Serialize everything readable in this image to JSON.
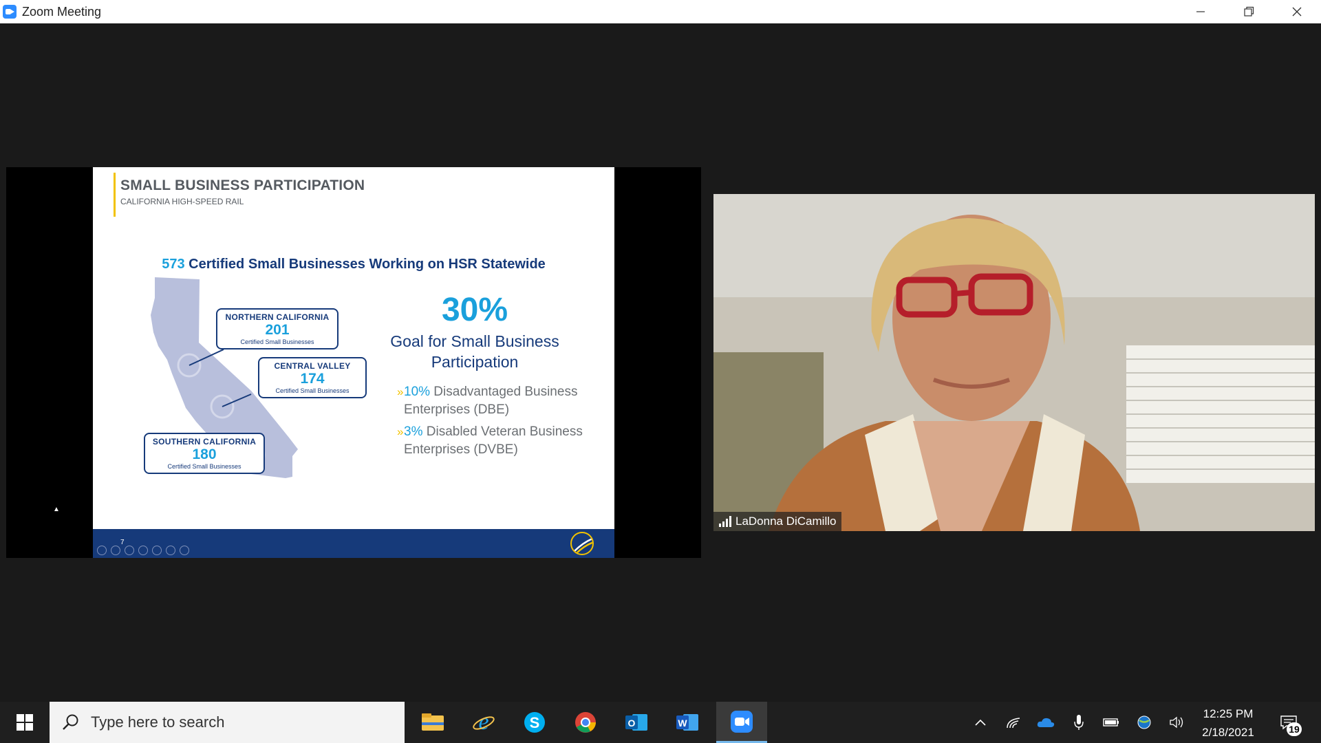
{
  "window": {
    "title": "Zoom Meeting",
    "controls": {
      "minimize": "—",
      "restore": "❐",
      "close": "✕"
    }
  },
  "slide": {
    "title": "SMALL BUSINESS PARTICIPATION",
    "subtitle": "CALIFORNIA HIGH-SPEED RAIL",
    "headline_number": "573",
    "headline_text": "Certified Small Businesses Working on HSR Statewide",
    "regions": [
      {
        "name": "NORTHERN CALIFORNIA",
        "count": "201",
        "label": "Certified Small Businesses"
      },
      {
        "name": "CENTRAL VALLEY",
        "count": "174",
        "label": "Certified Small Businesses"
      },
      {
        "name": "SOUTHERN CALIFORNIA",
        "count": "180",
        "label": "Certified Small Businesses"
      }
    ],
    "goal_percent": "30%",
    "goal_text": "Goal for Small Business Participation",
    "bullets": [
      {
        "chevron": "»",
        "percent": "10%",
        "text": " Disadvantaged Business Enterprises (DBE)"
      },
      {
        "chevron": "»",
        "percent": "3%",
        "text": " Disabled Veteran Business Enterprises (DVBE)"
      }
    ],
    "page_number": "7",
    "accent_color": "#1aa0dc",
    "brand_color": "#163a7a",
    "highlight_color": "#f2c200"
  },
  "participant": {
    "name": "LaDonna DiCamillo"
  },
  "taskbar": {
    "search_placeholder": "Type here to search",
    "apps": [
      "file-explorer-icon",
      "internet-explorer-icon",
      "skype-icon",
      "chrome-icon",
      "outlook-icon",
      "word-icon",
      "zoom-icon"
    ],
    "time": "12:25 PM",
    "date": "2/18/2021",
    "notification_count": "19"
  }
}
